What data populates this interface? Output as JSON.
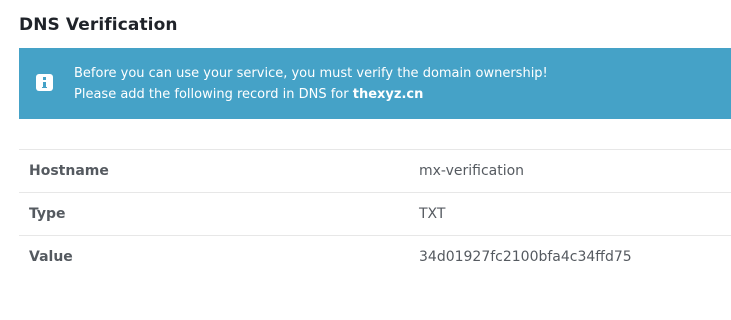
{
  "page": {
    "title": "DNS Verification"
  },
  "alert": {
    "icon": "info-icon",
    "line1": "Before you can use your service, you must verify the domain ownership!",
    "line2_prefix": "Please add the following record in DNS for ",
    "domain": "thexyz.cn",
    "background_color": "#45a2c7"
  },
  "record": {
    "rows": [
      {
        "label": "Hostname",
        "value": "mx-verification"
      },
      {
        "label": "Type",
        "value": "TXT"
      },
      {
        "label": "Value",
        "value": "34d01927fc2100bfa4c34ffd75"
      }
    ]
  }
}
